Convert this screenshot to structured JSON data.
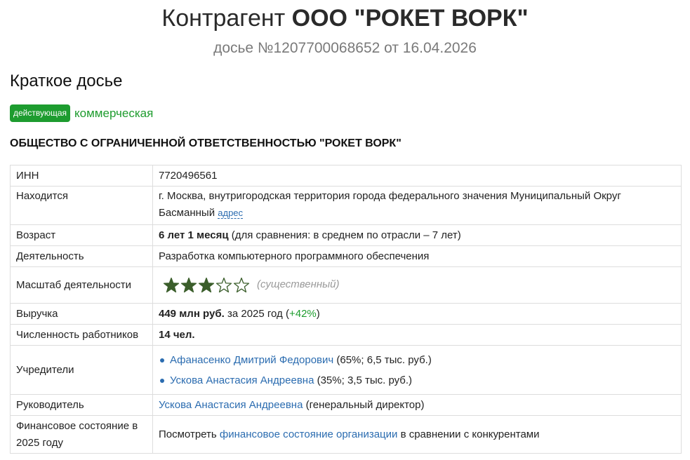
{
  "header": {
    "title_prefix": "Контрагент",
    "title_company": "ООО \"РОКЕТ ВОРК\"",
    "subtitle": "досье №1207700068652 от 16.04.2026"
  },
  "summary": {
    "heading": "Краткое досье",
    "status_badge": "действующая",
    "status_type": "коммерческая",
    "full_name": "ОБЩЕСТВО С ОГРАНИЧЕННОЙ ОТВЕТСТВЕННОСТЬЮ \"РОКЕТ ВОРК\""
  },
  "rows": {
    "inn": {
      "label": "ИНН",
      "value": "7720496561"
    },
    "location": {
      "label": "Находится",
      "value": "г. Москва, внутригородская территория города федерального значения Муниципальный Округ Басманный",
      "link": "адрес"
    },
    "age": {
      "label": "Возраст",
      "value_bold": "6 лет 1 месяц",
      "value_rest": " (для сравнения: в среднем по отрасли – 7 лет)"
    },
    "activity": {
      "label": "Деятельность",
      "value": "Разработка компьютерного программного обеспечения"
    },
    "scale": {
      "label": "Масштаб деятельности",
      "rating": 3,
      "max_rating": 5,
      "value": "(существенный)"
    },
    "revenue": {
      "label": "Выручка",
      "value_bold": "449 млн руб.",
      "year_text": " за 2025 год (",
      "change": "+42%",
      "close": ")"
    },
    "employees": {
      "label": "Численность работников",
      "value": "14 чел."
    },
    "founders": {
      "label": "Учредители",
      "items": [
        {
          "name": "Афанасенко Дмитрий Федорович",
          "share": " (65%; 6,5 тыс. руб.)"
        },
        {
          "name": "Ускова Анастасия Андреевна",
          "share": " (35%; 3,5 тыс. руб.)"
        }
      ]
    },
    "director": {
      "label": "Руководитель",
      "name": "Ускова Анастасия Андреевна",
      "role": " (генеральный директор)"
    },
    "finance": {
      "label": "Финансовое состояние в 2025 году",
      "prefix": "Посмотреть ",
      "link": "финансовое состояние организации",
      "suffix": " в сравнении с конкурентами"
    }
  },
  "colors": {
    "accent_green": "#1d9c2f",
    "link_blue": "#2b6cb0",
    "star_green": "#3b5e2b"
  }
}
